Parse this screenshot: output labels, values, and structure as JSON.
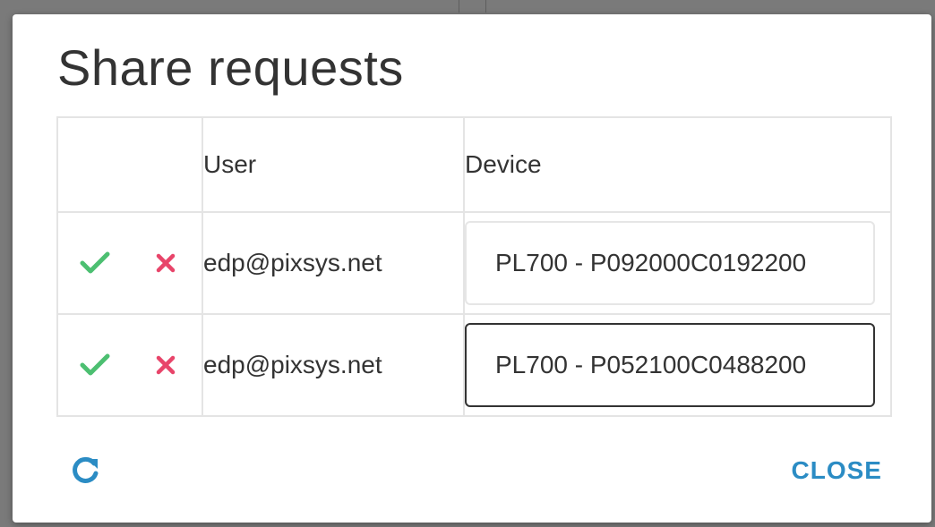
{
  "dialog": {
    "title": "Share requests"
  },
  "table": {
    "columns": [
      "",
      "User",
      "Device"
    ],
    "rows": [
      {
        "user": "edp@pixsys.net",
        "device": "PL700 - P092000C0192200"
      },
      {
        "user": "edp@pixsys.net",
        "device": "PL700 - P052100C0488200"
      }
    ]
  },
  "footer": {
    "close_label": "CLOSE"
  },
  "icons": {
    "approve": "check-icon",
    "reject": "close-x-icon",
    "refresh": "refresh-icon"
  },
  "colors": {
    "approve": "#4cbf71",
    "reject": "#e8456a",
    "accent": "#2b8cc4",
    "title": "#333333"
  }
}
